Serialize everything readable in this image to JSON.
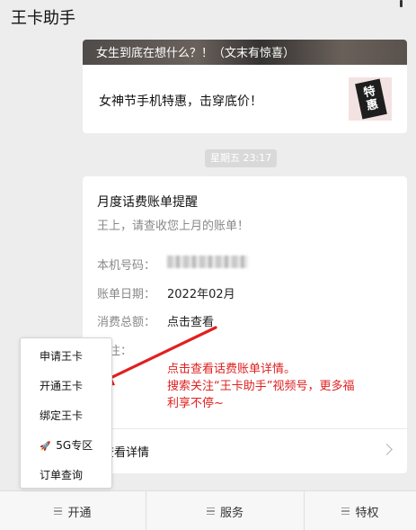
{
  "header": {
    "title": "王卡助手"
  },
  "article": {
    "banner_title": "女生到底在想什么？！（文末有惊喜）",
    "subtitle": "女神节手机特惠，击穿底价！",
    "thumb_text_1": "特",
    "thumb_text_2": "惠"
  },
  "timestamp": "星期五  23:17",
  "bill": {
    "title": "月度话费账单提醒",
    "greeting": "王上，请查收您上月的账单！",
    "rows": [
      {
        "label": "本机号码：",
        "value": ""
      },
      {
        "label": "账单日期：",
        "value": "2022年02月"
      },
      {
        "label": "消费总额：",
        "value": "点击查看"
      },
      {
        "label": "备注：",
        "value": ""
      }
    ],
    "annotation": [
      "点击查看话费账单详情。",
      "搜索关注“王卡助手”视频号，更多福",
      "利享不停~"
    ],
    "detail_link": "查看详情"
  },
  "popup_menu": {
    "items": [
      {
        "label": "申请王卡"
      },
      {
        "label": "开通王卡"
      },
      {
        "label": "绑定王卡"
      },
      {
        "label": "5G专区",
        "icon": "rocket-icon"
      },
      {
        "label": "订单查询"
      }
    ]
  },
  "bottom_nav": {
    "items": [
      {
        "label": "开通"
      },
      {
        "label": "服务"
      },
      {
        "label": "特权"
      }
    ]
  },
  "colors": {
    "annotation": "#e02020",
    "arrow": "#e02020",
    "background": "#ededed"
  }
}
